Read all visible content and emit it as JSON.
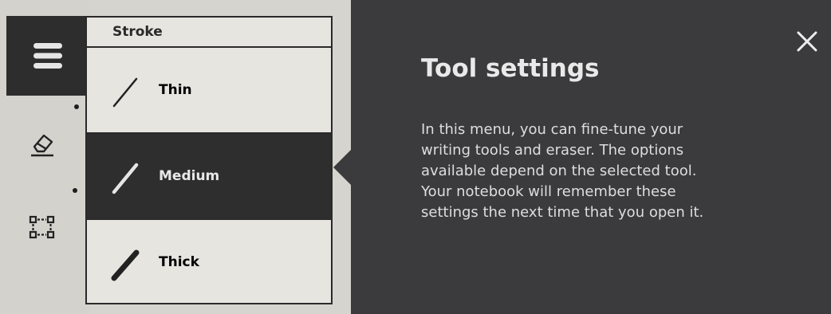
{
  "panel": {
    "header": "Stroke",
    "options": [
      {
        "label": "Thin",
        "selected": false
      },
      {
        "label": "Medium",
        "selected": true
      },
      {
        "label": "Thick",
        "selected": false
      }
    ]
  },
  "toolbar": {
    "icons": [
      "menu-icon",
      "eraser-icon",
      "select-icon"
    ]
  },
  "help": {
    "title": "Tool settings",
    "body_lines": [
      "In this menu, you can fine-tune your",
      "writing tools and eraser. The options",
      "available depend on the selected tool.",
      "Your notebook will remember these",
      "settings the next time that you open it."
    ]
  },
  "colors": {
    "overlay": "#3b3a3c",
    "selected": "#2f2e2f",
    "panel": "#e6e5e0"
  }
}
